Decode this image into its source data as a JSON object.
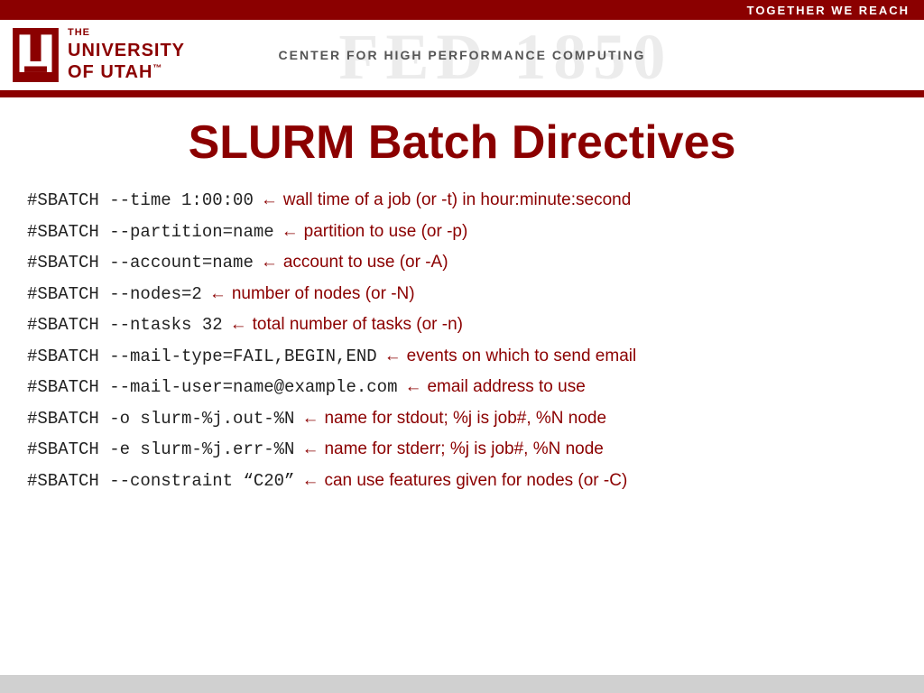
{
  "header": {
    "tagline": "TOGETHER WE REACH",
    "center_title": "CENTER FOR HIGH PERFORMANCE COMPUTING",
    "logo_the": "THE",
    "logo_university": "UNIVERSITY",
    "logo_of_utah": "OF UTAH"
  },
  "slide": {
    "title": "SLURM Batch Directives",
    "directives": [
      {
        "code": "#SBATCH --time 1:00:00",
        "arrow": "←",
        "description": "wall time of a job (or -t) in hour:minute:second"
      },
      {
        "code": "#SBATCH --partition=name",
        "arrow": "←",
        "description": "partition to use (or -p)"
      },
      {
        "code": "#SBATCH --account=name",
        "arrow": "←",
        "description": "account to use (or -A)"
      },
      {
        "code": "#SBATCH --nodes=2",
        "arrow": "←",
        "description": "number of nodes (or -N)"
      },
      {
        "code": "#SBATCH --ntasks 32",
        "arrow": "←",
        "description": "total number of tasks (or -n)"
      },
      {
        "code": "#SBATCH --mail-type=FAIL,BEGIN,END",
        "arrow": "←",
        "description": "events on which to send email"
      },
      {
        "code": "#SBATCH --mail-user=name@example.com",
        "arrow": "←",
        "description": "email address to use"
      },
      {
        "code": "#SBATCH -o slurm-%j.out-%N",
        "arrow": "←",
        "description": "name for stdout; %j is job#, %N node"
      },
      {
        "code": "#SBATCH -e slurm-%j.err-%N",
        "arrow": "←",
        "description": "name for stderr; %j is job#, %N node"
      },
      {
        "code": "#SBATCH --constraint  “C20”",
        "arrow": "←",
        "description": "can use features given for nodes (or -C)"
      }
    ]
  }
}
